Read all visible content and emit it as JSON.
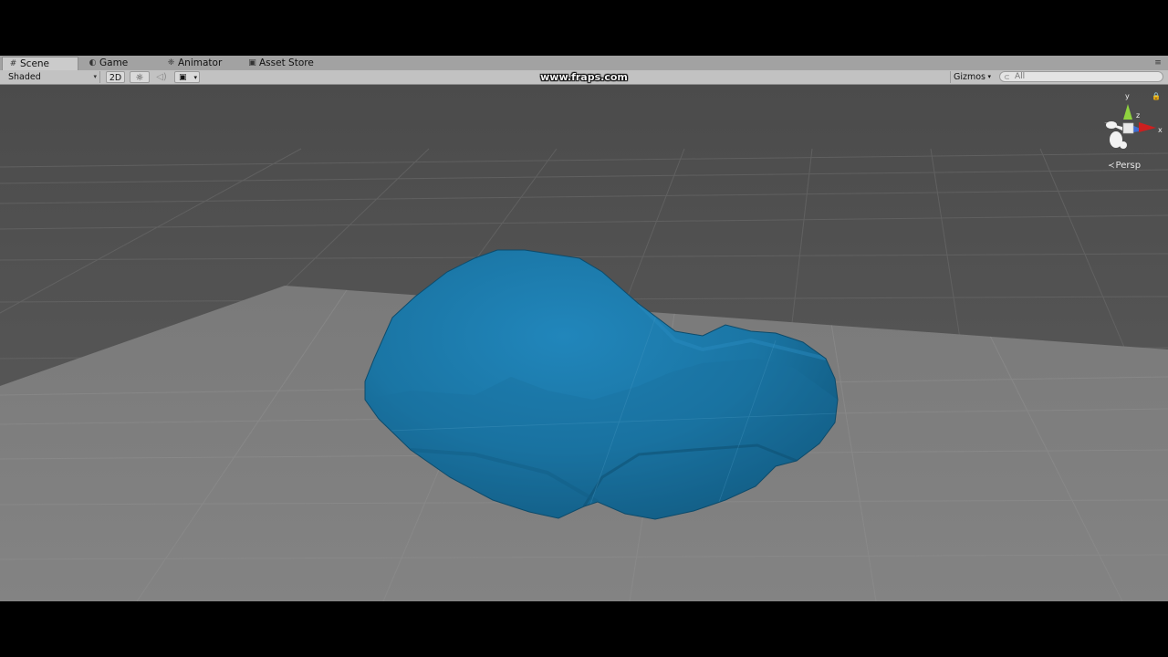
{
  "tabs": {
    "scene": {
      "label": "Scene",
      "icon": "#"
    },
    "game": {
      "label": "Game",
      "icon": "◐"
    },
    "animator": {
      "label": "Animator",
      "icon": "❈"
    },
    "asset_store": {
      "label": "Asset Store",
      "icon": "▣"
    },
    "menu_icon": "≡"
  },
  "toolbar": {
    "shading_mode": "Shaded",
    "dropdown_arrow": "▾",
    "mode_2d": "2D",
    "lighting_icon": "☼",
    "audio_icon": "◁)",
    "effects_icon": "▣",
    "watermark": "www.fraps.com",
    "gizmos_label": "Gizmos",
    "search_placeholder": "All",
    "search_icon": "⊂"
  },
  "scene_view": {
    "projection": "Persp",
    "projection_icon": "≺",
    "lock_icon": "🔒",
    "axes": {
      "x": "x",
      "y": "y",
      "z": "z"
    },
    "colors": {
      "sky": "#515151",
      "ground": "#7f7f7f",
      "object": "#1a78a8",
      "x_axis": "#cc1f1f",
      "y_axis": "#8fd33f",
      "z_axis": "#3d6bd1"
    }
  }
}
